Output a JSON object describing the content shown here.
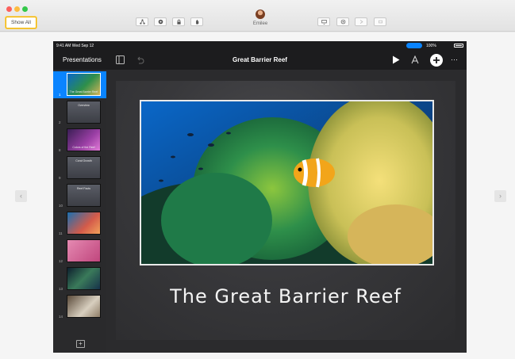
{
  "window": {
    "show_all_label": "Show All",
    "toolbar_icons": [
      "share-icon",
      "settings-icon",
      "lock-icon",
      "hand-icon",
      "screen-icon",
      "airplay-icon",
      "forward-icon",
      "stop-icon"
    ],
    "user_name": "Emilee"
  },
  "ipad": {
    "status": {
      "time": "9:41 AM  Wed Sep 12",
      "battery": "100%"
    },
    "toolbar": {
      "back_label": "Presentations",
      "document_title": "Great Barrier Reef"
    },
    "navigator": {
      "slides": [
        {
          "number": "1",
          "label": "The Great Barrier Reef",
          "selected": true,
          "style": "reef"
        },
        {
          "number": "2",
          "label": "Overview",
          "selected": false,
          "style": "text"
        },
        {
          "number": "8",
          "label": "Colors of the Reef",
          "selected": false,
          "style": "purple"
        },
        {
          "number": "9",
          "label": "Coral Growth",
          "selected": false,
          "style": "text"
        },
        {
          "number": "10",
          "label": "Reef Facts",
          "selected": false,
          "style": "text"
        },
        {
          "number": "11",
          "label": "",
          "selected": false,
          "style": "coral-blue"
        },
        {
          "number": "12",
          "label": "",
          "selected": false,
          "style": "coral-pink"
        },
        {
          "number": "13",
          "label": "",
          "selected": false,
          "style": "dark-reef"
        },
        {
          "number": "14",
          "label": "",
          "selected": false,
          "style": "coral-white"
        }
      ]
    },
    "slide": {
      "title": "The Great Barrier Reef"
    }
  },
  "colors": {
    "accent": "#0a84ff",
    "ipad_background": "#1c1c1e",
    "slide_background": "#3a3a3d"
  }
}
